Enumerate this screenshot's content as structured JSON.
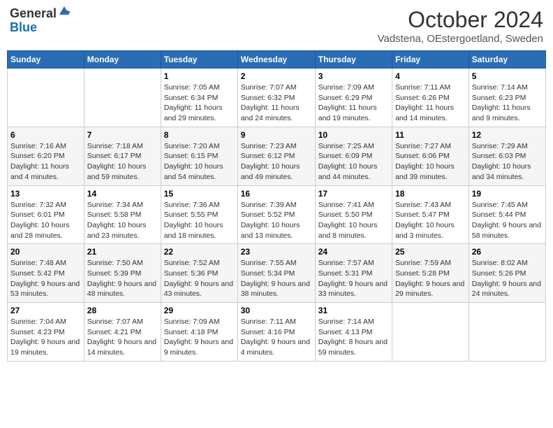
{
  "header": {
    "logo_general": "General",
    "logo_blue": "Blue",
    "title": "October 2024",
    "subtitle": "Vadstena, OEstergoetland, Sweden"
  },
  "days_of_week": [
    "Sunday",
    "Monday",
    "Tuesday",
    "Wednesday",
    "Thursday",
    "Friday",
    "Saturday"
  ],
  "weeks": [
    [
      {
        "day": "",
        "info": ""
      },
      {
        "day": "",
        "info": ""
      },
      {
        "day": "1",
        "info": "Sunrise: 7:05 AM\nSunset: 6:34 PM\nDaylight: 11 hours and 29 minutes."
      },
      {
        "day": "2",
        "info": "Sunrise: 7:07 AM\nSunset: 6:32 PM\nDaylight: 11 hours and 24 minutes."
      },
      {
        "day": "3",
        "info": "Sunrise: 7:09 AM\nSunset: 6:29 PM\nDaylight: 11 hours and 19 minutes."
      },
      {
        "day": "4",
        "info": "Sunrise: 7:11 AM\nSunset: 6:26 PM\nDaylight: 11 hours and 14 minutes."
      },
      {
        "day": "5",
        "info": "Sunrise: 7:14 AM\nSunset: 6:23 PM\nDaylight: 11 hours and 9 minutes."
      }
    ],
    [
      {
        "day": "6",
        "info": "Sunrise: 7:16 AM\nSunset: 6:20 PM\nDaylight: 11 hours and 4 minutes."
      },
      {
        "day": "7",
        "info": "Sunrise: 7:18 AM\nSunset: 6:17 PM\nDaylight: 10 hours and 59 minutes."
      },
      {
        "day": "8",
        "info": "Sunrise: 7:20 AM\nSunset: 6:15 PM\nDaylight: 10 hours and 54 minutes."
      },
      {
        "day": "9",
        "info": "Sunrise: 7:23 AM\nSunset: 6:12 PM\nDaylight: 10 hours and 49 minutes."
      },
      {
        "day": "10",
        "info": "Sunrise: 7:25 AM\nSunset: 6:09 PM\nDaylight: 10 hours and 44 minutes."
      },
      {
        "day": "11",
        "info": "Sunrise: 7:27 AM\nSunset: 6:06 PM\nDaylight: 10 hours and 39 minutes."
      },
      {
        "day": "12",
        "info": "Sunrise: 7:29 AM\nSunset: 6:03 PM\nDaylight: 10 hours and 34 minutes."
      }
    ],
    [
      {
        "day": "13",
        "info": "Sunrise: 7:32 AM\nSunset: 6:01 PM\nDaylight: 10 hours and 28 minutes."
      },
      {
        "day": "14",
        "info": "Sunrise: 7:34 AM\nSunset: 5:58 PM\nDaylight: 10 hours and 23 minutes."
      },
      {
        "day": "15",
        "info": "Sunrise: 7:36 AM\nSunset: 5:55 PM\nDaylight: 10 hours and 18 minutes."
      },
      {
        "day": "16",
        "info": "Sunrise: 7:39 AM\nSunset: 5:52 PM\nDaylight: 10 hours and 13 minutes."
      },
      {
        "day": "17",
        "info": "Sunrise: 7:41 AM\nSunset: 5:50 PM\nDaylight: 10 hours and 8 minutes."
      },
      {
        "day": "18",
        "info": "Sunrise: 7:43 AM\nSunset: 5:47 PM\nDaylight: 10 hours and 3 minutes."
      },
      {
        "day": "19",
        "info": "Sunrise: 7:45 AM\nSunset: 5:44 PM\nDaylight: 9 hours and 58 minutes."
      }
    ],
    [
      {
        "day": "20",
        "info": "Sunrise: 7:48 AM\nSunset: 5:42 PM\nDaylight: 9 hours and 53 minutes."
      },
      {
        "day": "21",
        "info": "Sunrise: 7:50 AM\nSunset: 5:39 PM\nDaylight: 9 hours and 48 minutes."
      },
      {
        "day": "22",
        "info": "Sunrise: 7:52 AM\nSunset: 5:36 PM\nDaylight: 9 hours and 43 minutes."
      },
      {
        "day": "23",
        "info": "Sunrise: 7:55 AM\nSunset: 5:34 PM\nDaylight: 9 hours and 38 minutes."
      },
      {
        "day": "24",
        "info": "Sunrise: 7:57 AM\nSunset: 5:31 PM\nDaylight: 9 hours and 33 minutes."
      },
      {
        "day": "25",
        "info": "Sunrise: 7:59 AM\nSunset: 5:28 PM\nDaylight: 9 hours and 29 minutes."
      },
      {
        "day": "26",
        "info": "Sunrise: 8:02 AM\nSunset: 5:26 PM\nDaylight: 9 hours and 24 minutes."
      }
    ],
    [
      {
        "day": "27",
        "info": "Sunrise: 7:04 AM\nSunset: 4:23 PM\nDaylight: 9 hours and 19 minutes."
      },
      {
        "day": "28",
        "info": "Sunrise: 7:07 AM\nSunset: 4:21 PM\nDaylight: 9 hours and 14 minutes."
      },
      {
        "day": "29",
        "info": "Sunrise: 7:09 AM\nSunset: 4:18 PM\nDaylight: 9 hours and 9 minutes."
      },
      {
        "day": "30",
        "info": "Sunrise: 7:11 AM\nSunset: 4:16 PM\nDaylight: 9 hours and 4 minutes."
      },
      {
        "day": "31",
        "info": "Sunrise: 7:14 AM\nSunset: 4:13 PM\nDaylight: 8 hours and 59 minutes."
      },
      {
        "day": "",
        "info": ""
      },
      {
        "day": "",
        "info": ""
      }
    ]
  ]
}
